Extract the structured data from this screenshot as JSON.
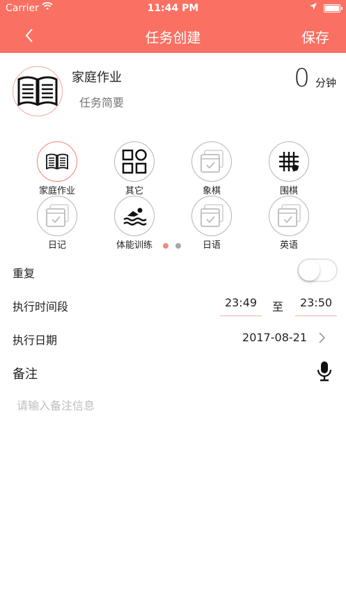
{
  "status_bar": {
    "carrier": "Carrier",
    "time": "11:44 PM"
  },
  "nav": {
    "title": "任务创建",
    "save_label": "保存"
  },
  "task": {
    "name": "家庭作业",
    "summary_placeholder": "任务简要",
    "minutes_value": "0",
    "minutes_unit": "分钟"
  },
  "categories": [
    {
      "label": "家庭作业",
      "icon": "book-icon",
      "active": true
    },
    {
      "label": "其它",
      "icon": "grid-icon",
      "active": false
    },
    {
      "label": "象棋",
      "icon": "calendar-check-icon",
      "active": false
    },
    {
      "label": "围棋",
      "icon": "go-board-icon",
      "active": false
    },
    {
      "label": "日记",
      "icon": "calendar-check-icon",
      "active": false
    },
    {
      "label": "体能训练",
      "icon": "swimmer-icon",
      "active": false
    },
    {
      "label": "日语",
      "icon": "calendar-check-icon",
      "active": false
    },
    {
      "label": "英语",
      "icon": "calendar-check-icon",
      "active": false
    }
  ],
  "pager": {
    "count": 2,
    "current_page": 1
  },
  "repeat": {
    "label": "重复",
    "enabled": false
  },
  "period": {
    "label": "执行时间段",
    "start": "23:49",
    "separator": "至",
    "end": "23:50"
  },
  "date": {
    "label": "执行日期",
    "value": "2017-08-21"
  },
  "notes": {
    "label": "备注",
    "placeholder": "请输入备注信息",
    "value": ""
  },
  "colors": {
    "header": "#fa7062",
    "accent_border": "#f3826f",
    "dot_active": "#f5897a",
    "dot_inactive": "#a8a8a8"
  }
}
